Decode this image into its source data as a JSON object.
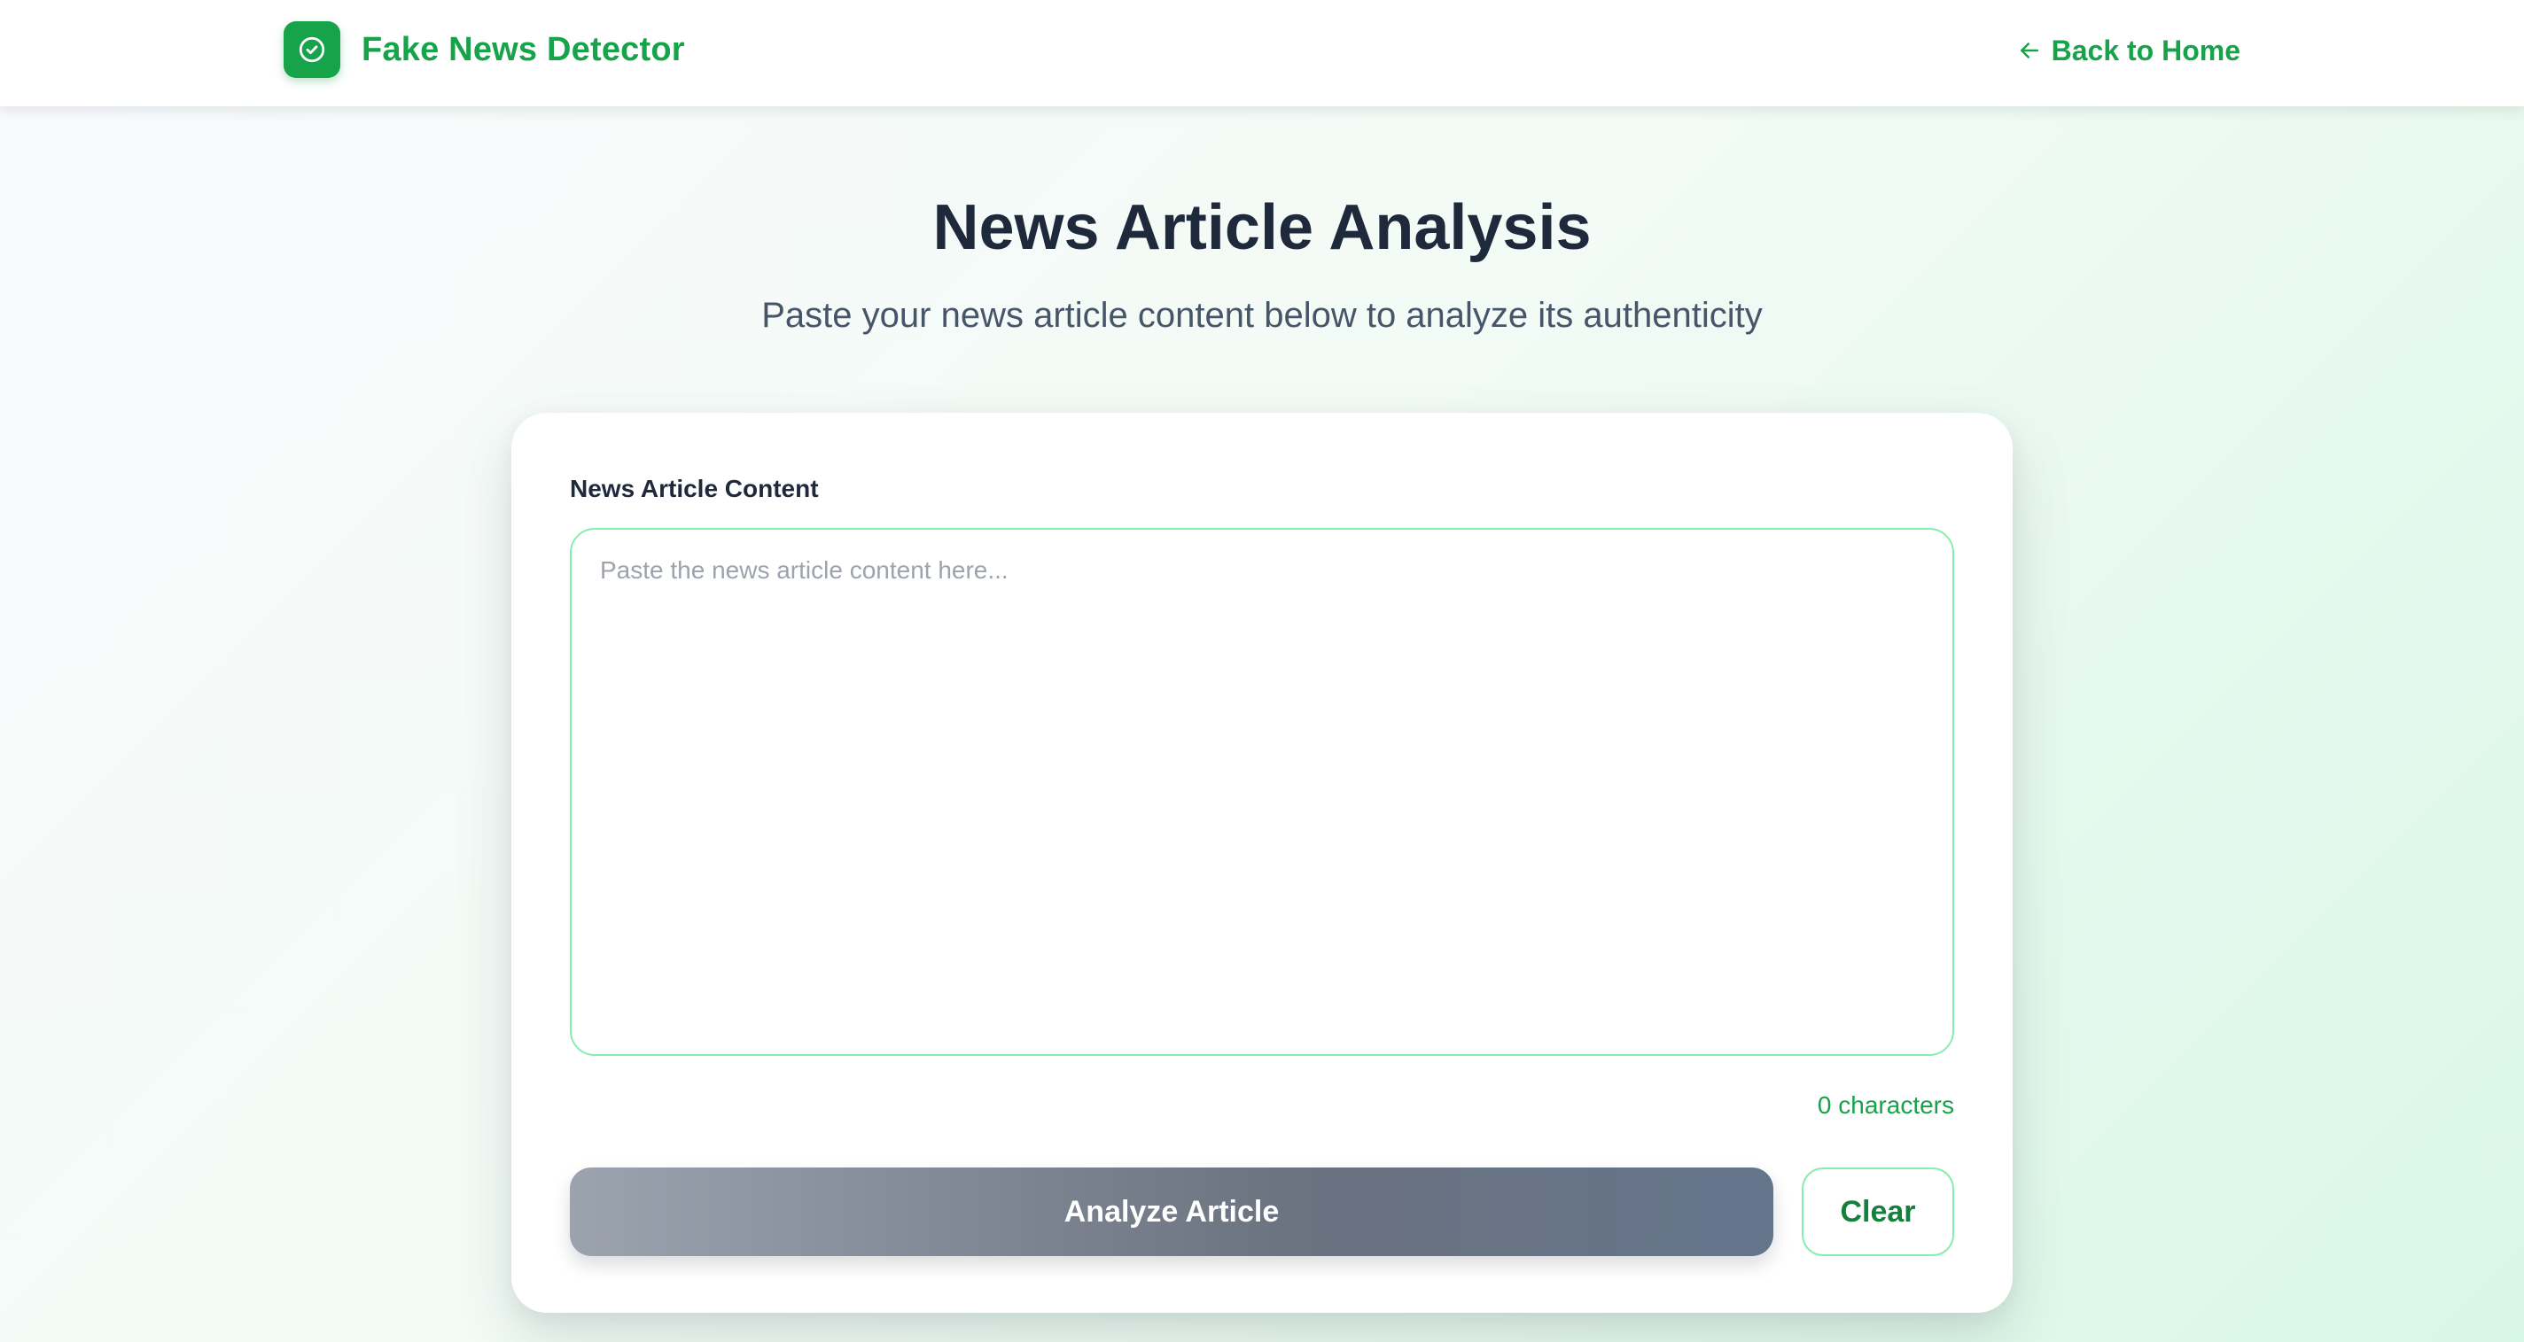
{
  "header": {
    "brand_title": "Fake News Detector",
    "back_label": "Back to Home"
  },
  "hero": {
    "title": "News Article Analysis",
    "subtitle": "Paste your news article content below to analyze its authenticity"
  },
  "form": {
    "field_label": "News Article Content",
    "textarea_value": "",
    "textarea_placeholder": "Paste the news article content here...",
    "char_count": "0 characters",
    "analyze_label": "Analyze Article",
    "clear_label": "Clear"
  },
  "colors": {
    "brand_green": "#16a34a",
    "heading": "#1e293b",
    "input_border": "#86efac",
    "analyze_disabled_start": "#9ca3af",
    "analyze_disabled_end": "#64748b"
  },
  "icons": {
    "brand": "check-circle-icon",
    "back": "arrow-left-icon"
  }
}
